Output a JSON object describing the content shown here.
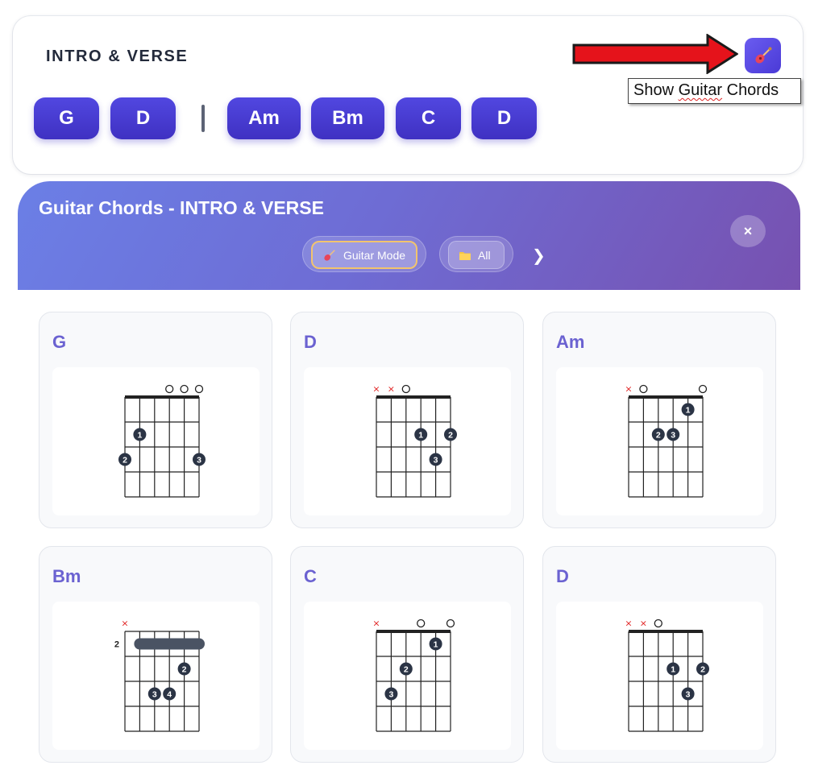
{
  "section": {
    "title": "INTRO & VERSE",
    "chords": [
      "G",
      "D",
      "Am",
      "Bm",
      "C",
      "D"
    ],
    "separator_after_index": 1
  },
  "toolbar": {
    "guitar_toggle_icon": "guitar-icon",
    "tooltip": "Show Guitar Chords",
    "tooltip_plain": "Show ",
    "tooltip_squiggle": "Guitar",
    "tooltip_rest": " Chords"
  },
  "panel": {
    "title": "Guitar Chords - INTRO & VERSE",
    "mode_label": "Guitar Mode",
    "filter_label": "All",
    "next_icon": "❯",
    "close_icon": "×"
  },
  "colors": {
    "accent": "#4a3fd6",
    "card_title": "#6b62d1",
    "finger_dot": "#2b3445",
    "muted_marker": "#e02020"
  },
  "chord_cards": [
    {
      "name": "G",
      "strings": [
        "",
        "",
        "",
        "o",
        "o",
        "o"
      ],
      "base_fret": null,
      "fingers": [
        {
          "string": 2,
          "fret": 2,
          "finger": "1"
        },
        {
          "string": 1,
          "fret": 3,
          "finger": "2"
        },
        {
          "string": 6,
          "fret": 3,
          "finger": "3"
        }
      ],
      "barre": null
    },
    {
      "name": "D",
      "strings": [
        "x",
        "x",
        "o",
        "",
        "",
        ""
      ],
      "base_fret": null,
      "fingers": [
        {
          "string": 4,
          "fret": 2,
          "finger": "1"
        },
        {
          "string": 6,
          "fret": 2,
          "finger": "2"
        },
        {
          "string": 5,
          "fret": 3,
          "finger": "3"
        }
      ],
      "barre": null
    },
    {
      "name": "Am",
      "strings": [
        "x",
        "o",
        "",
        "",
        "",
        "o"
      ],
      "base_fret": null,
      "fingers": [
        {
          "string": 5,
          "fret": 1,
          "finger": "1"
        },
        {
          "string": 3,
          "fret": 2,
          "finger": "2"
        },
        {
          "string": 4,
          "fret": 2,
          "finger": "3"
        }
      ],
      "barre": null
    },
    {
      "name": "Bm",
      "strings": [
        "x",
        "",
        "",
        "",
        "",
        ""
      ],
      "base_fret": "2",
      "fingers": [
        {
          "string": 5,
          "fret": 2,
          "finger": "2"
        },
        {
          "string": 3,
          "fret": 3,
          "finger": "3"
        },
        {
          "string": 4,
          "fret": 3,
          "finger": "4"
        }
      ],
      "barre": {
        "fret": 1,
        "from_string": 2,
        "to_string": 6
      }
    },
    {
      "name": "C",
      "strings": [
        "x",
        "",
        "",
        "o",
        "",
        "o"
      ],
      "base_fret": null,
      "fingers": [
        {
          "string": 5,
          "fret": 1,
          "finger": "1"
        },
        {
          "string": 3,
          "fret": 2,
          "finger": "2"
        },
        {
          "string": 2,
          "fret": 3,
          "finger": "3"
        }
      ],
      "barre": null
    },
    {
      "name": "D",
      "strings": [
        "x",
        "x",
        "o",
        "",
        "",
        ""
      ],
      "base_fret": null,
      "fingers": [
        {
          "string": 4,
          "fret": 2,
          "finger": "1"
        },
        {
          "string": 6,
          "fret": 2,
          "finger": "2"
        },
        {
          "string": 5,
          "fret": 3,
          "finger": "3"
        }
      ],
      "barre": null
    }
  ]
}
